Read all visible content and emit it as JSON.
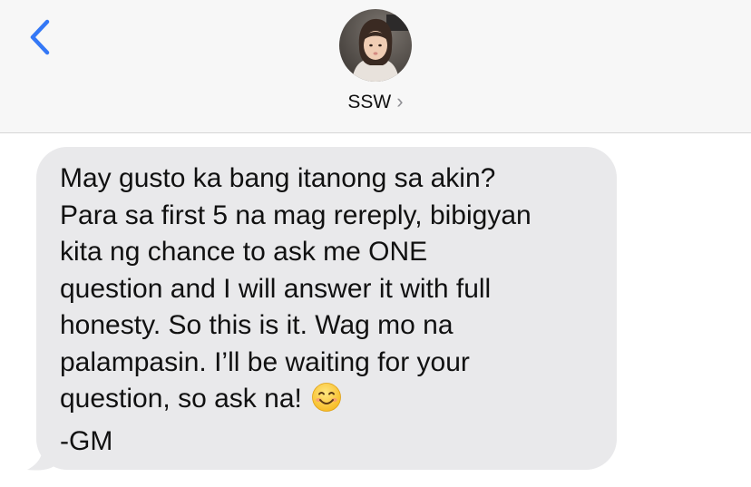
{
  "header": {
    "back_icon": "chevron-left-icon",
    "contact_name": "SSW",
    "disclosure_icon": "chevron-right-icon",
    "accent_color": "#3478f6"
  },
  "message": {
    "text": "May gusto ka bang itanong sa akin?\nPara sa first 5 na mag rereply, bibigyan\nkita ng chance to ask me ONE\nquestion and I will answer it with full\nhonesty. So this is it. Wag mo na\npalampasin. I’ll be waiting for your\nquestion, so ask na!",
    "emoji": "smiling-face-emoji",
    "signature": "-GM",
    "bubble_color": "#e9e9eb"
  }
}
